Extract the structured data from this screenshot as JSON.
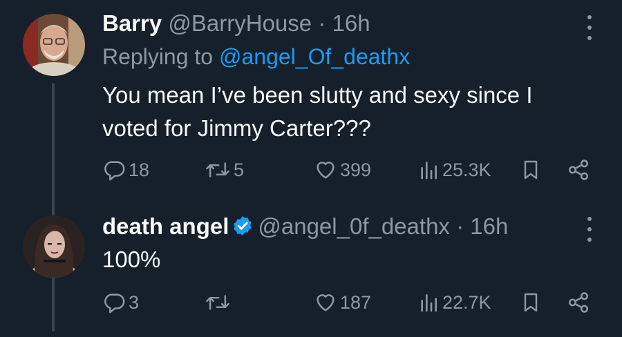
{
  "tweets": [
    {
      "name": "Barry",
      "handle": "@BarryHouse",
      "separator": "·",
      "time": "16h",
      "replying_prefix": "Replying to",
      "replying_handle": "@angel_Of_deathx",
      "text_lines": [
        "You mean I’ve been slutty and sexy since I",
        "voted for Jimmy Carter???"
      ],
      "replies": "18",
      "retweets": "5",
      "likes": "399",
      "views": "25.3K"
    },
    {
      "name": "death angel",
      "verified": true,
      "handle": "@angel_0f_deathx",
      "separator": "·",
      "time": "16h",
      "text_lines": [
        "100%"
      ],
      "replies": "3",
      "retweets": "",
      "likes": "187",
      "views": "22.7K"
    }
  ],
  "colors": {
    "background": "#15202b",
    "text_primary": "#f7f9f9",
    "text_secondary": "#8b98a5",
    "link": "#1d9bf0",
    "verified_badge": "#1d9bf0"
  },
  "icons": [
    "more-icon",
    "reply-icon",
    "retweet-icon",
    "like-icon",
    "views-icon",
    "bookmark-icon",
    "share-icon",
    "verified-badge-icon"
  ]
}
